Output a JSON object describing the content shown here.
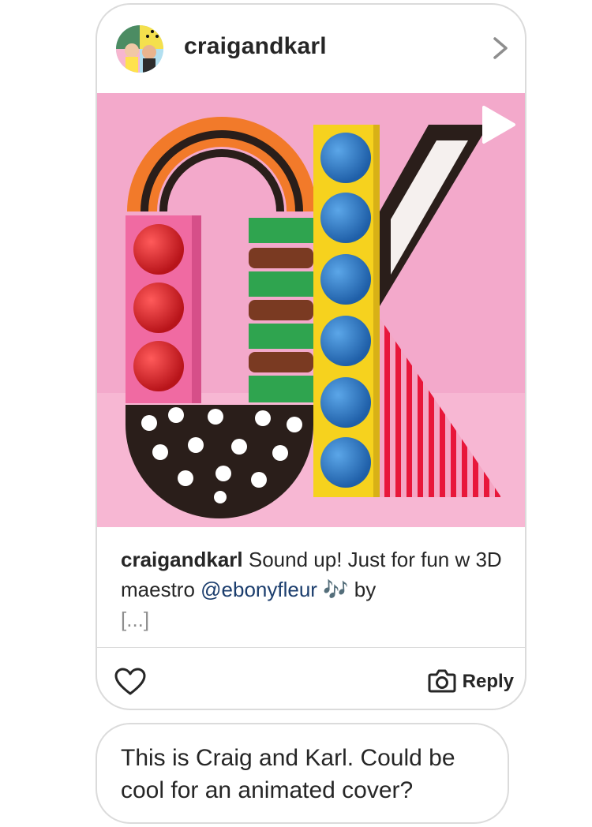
{
  "post": {
    "username": "craigandkarl",
    "caption": {
      "username": "craigandkarl",
      "text_before": " Sound up! Just for fun w 3D maestro ",
      "mention": "@ebonyfleur",
      "text_after": " 🎶 by",
      "more": "[...]"
    },
    "image_icon": "play-icon"
  },
  "actions": {
    "like_icon": "heart-icon",
    "reply_icon": "camera-icon",
    "reply_label": "Reply"
  },
  "message": {
    "text": "This is Craig and Karl. Could be cool for an animated cover?"
  }
}
